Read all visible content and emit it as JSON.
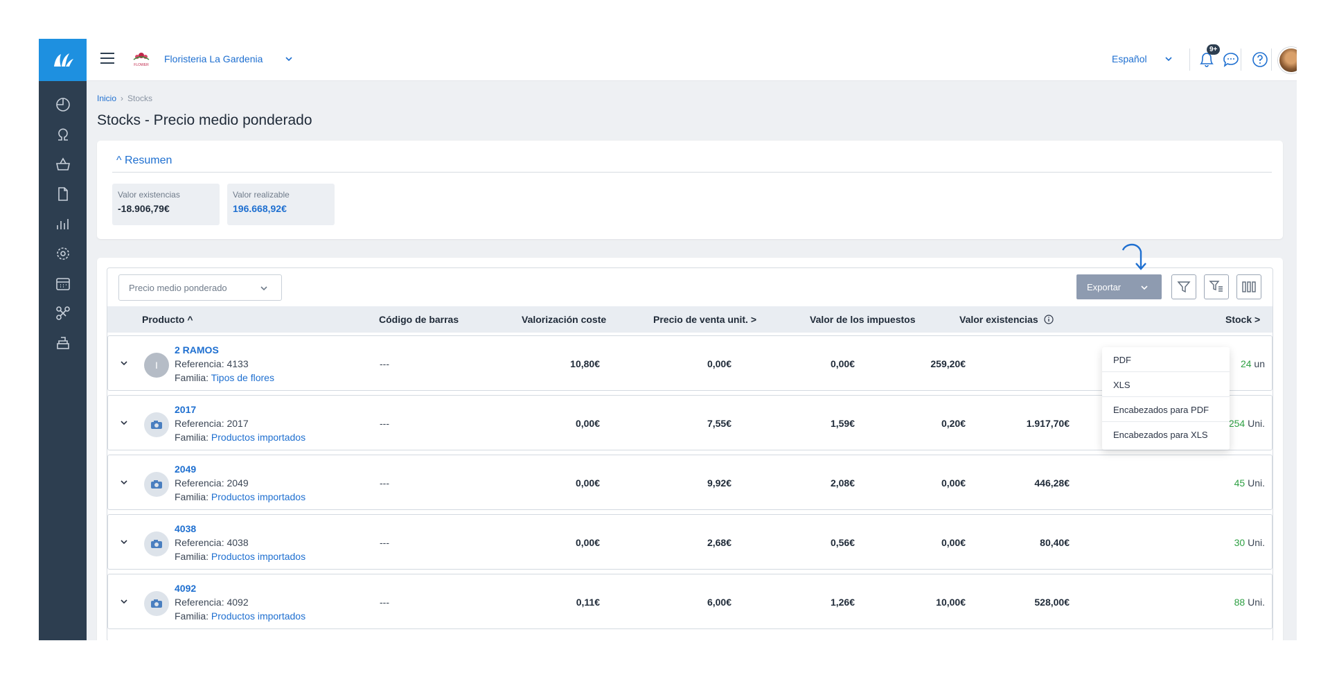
{
  "header": {
    "company": "Floristeria La Gardenia",
    "logo_text": "FLOWER",
    "language": "Español",
    "notification_badge": "9+"
  },
  "breadcrumb": {
    "home": "Inicio",
    "separator": "›",
    "current": "Stocks"
  },
  "page_title": "Stocks - Precio medio ponderado",
  "summary": {
    "toggle": "^ Resumen",
    "kpis": [
      {
        "label": "Valor existencias",
        "value": "-18.906,79€"
      },
      {
        "label": "Valor realizable",
        "value": "196.668,92€"
      }
    ]
  },
  "toolbar": {
    "method_select": "Precio medio ponderado",
    "export_label": "Exportar"
  },
  "export_menu": [
    "PDF",
    "XLS",
    "Encabezados para PDF",
    "Encabezados para XLS"
  ],
  "table": {
    "columns": {
      "product": "Producto ^",
      "barcode": "Código de barras",
      "cost_valuation": "Valorización coste",
      "unit_price": "Precio de venta unit. >",
      "tax_value": "Valor de los impuestos",
      "stock_value": "Valor existencias",
      "stock": "Stock >"
    },
    "ref_prefix": "Referencia: ",
    "family_prefix": "Familia: ",
    "rows": [
      {
        "name": "2 RAMOS",
        "thumb": "I",
        "ref": "4133",
        "family": "Tipos de flores",
        "barcode": "---",
        "cost": "10,80€",
        "price": "0,00€",
        "tax": "0,00€",
        "stock_value": "259,20€",
        "realizable": "",
        "stock_qty": "24",
        "stock_unit": "un"
      },
      {
        "name": "2017",
        "thumb": "",
        "ref": "2017",
        "family": "Productos importados",
        "barcode": "---",
        "cost": "0,00€",
        "price": "7,55€",
        "tax": "1,59€",
        "stock_value": "0,20€",
        "realizable": "1.917,70€",
        "stock_qty": "254",
        "stock_unit": "Uni."
      },
      {
        "name": "2049",
        "thumb": "",
        "ref": "2049",
        "family": "Productos importados",
        "barcode": "---",
        "cost": "0,00€",
        "price": "9,92€",
        "tax": "2,08€",
        "stock_value": "0,00€",
        "realizable": "446,28€",
        "stock_qty": "45",
        "stock_unit": "Uni."
      },
      {
        "name": "4038",
        "thumb": "",
        "ref": "4038",
        "family": "Productos importados",
        "barcode": "---",
        "cost": "0,00€",
        "price": "2,68€",
        "tax": "0,56€",
        "stock_value": "0,00€",
        "realizable": "80,40€",
        "stock_qty": "30",
        "stock_unit": "Uni."
      },
      {
        "name": "4092",
        "thumb": "",
        "ref": "4092",
        "family": "Productos importados",
        "barcode": "---",
        "cost": "0,11€",
        "price": "6,00€",
        "tax": "1,26€",
        "stock_value": "10,00€",
        "realizable": "528,00€",
        "stock_qty": "88",
        "stock_unit": "Uni."
      }
    ]
  },
  "colors": {
    "sidebar": "#2d3e50",
    "accent": "#1e90e0",
    "link": "#1e6fd0",
    "stock_positive": "#2ea043",
    "export_button": "#8e9bb0"
  }
}
